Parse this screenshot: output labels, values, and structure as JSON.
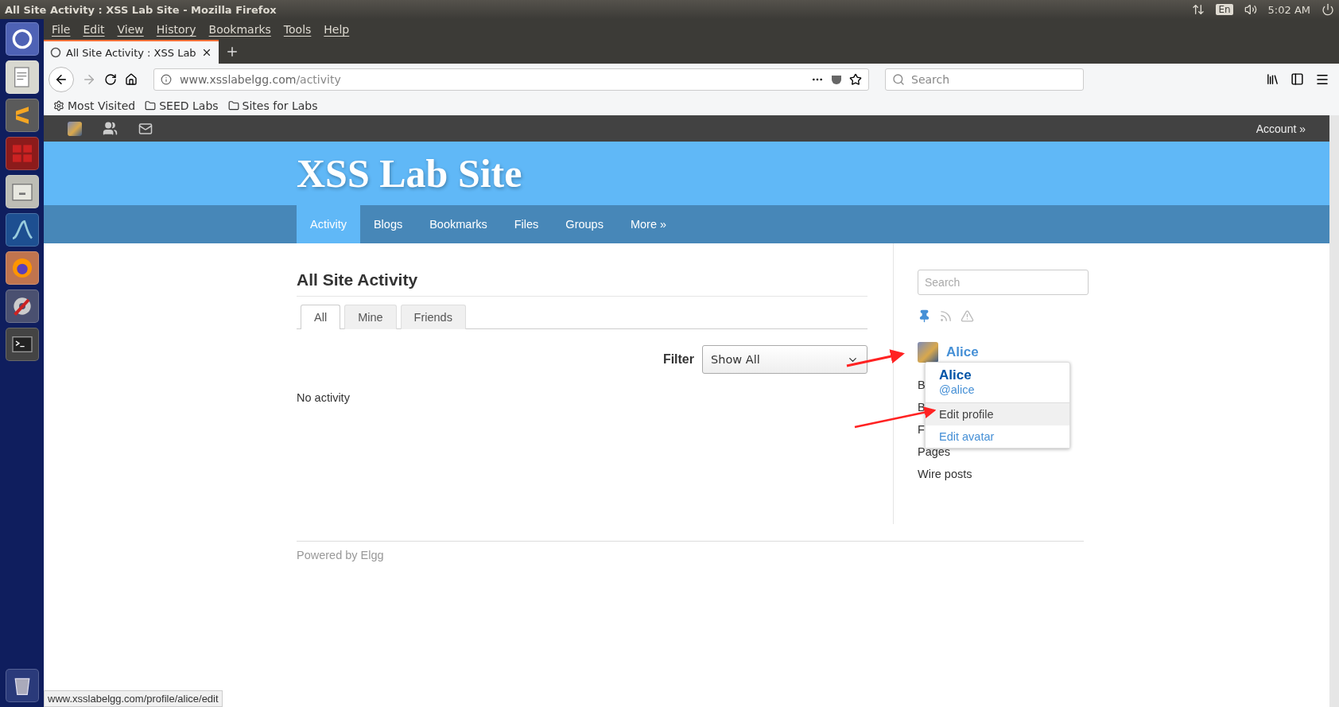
{
  "window": {
    "title": "All Site Activity : XSS Lab Site - Mozilla Firefox"
  },
  "system_tray": {
    "keyboard": "En",
    "time": "5:02 AM"
  },
  "launcher": [
    {
      "kind": "ubuntu"
    },
    {
      "kind": "editor"
    },
    {
      "kind": "sublime"
    },
    {
      "kind": "terminals"
    },
    {
      "kind": "files"
    },
    {
      "kind": "wireshark"
    },
    {
      "kind": "firefox"
    },
    {
      "kind": "settings"
    },
    {
      "kind": "terminal"
    }
  ],
  "menu_bar": [
    "File",
    "Edit",
    "View",
    "History",
    "Bookmarks",
    "Tools",
    "Help"
  ],
  "tabs": [
    {
      "label": "All Site Activity : XSS Lab",
      "selected": true
    }
  ],
  "address_bar": {
    "host": "www.xsslabelgg.com",
    "path": "/activity"
  },
  "search": {
    "placeholder": "Search"
  },
  "bookmarks": [
    "Most Visited",
    "SEED Labs",
    "Sites for Labs"
  ],
  "site": {
    "account": "Account »",
    "title": "XSS Lab Site",
    "nav": [
      {
        "label": "Activity",
        "selected": true
      },
      {
        "label": "Blogs",
        "selected": false
      },
      {
        "label": "Bookmarks",
        "selected": false
      },
      {
        "label": "Files",
        "selected": false
      },
      {
        "label": "Groups",
        "selected": false
      },
      {
        "label": "More »",
        "selected": false
      }
    ],
    "page_title": "All Site Activity",
    "filter_tabs": [
      {
        "label": "All",
        "selected": true
      },
      {
        "label": "Mine",
        "selected": false
      },
      {
        "label": "Friends",
        "selected": false
      }
    ],
    "filter_label": "Filter",
    "filter_value": "Show All",
    "empty": "No activity",
    "sidebar": {
      "search_placeholder": "Search",
      "user": "Alice",
      "links": [
        "B",
        "B",
        "F",
        "Pages",
        "Wire posts"
      ],
      "popup": {
        "name": "Alice",
        "handle": "@alice",
        "items": [
          {
            "label": "Edit profile",
            "selected": true
          },
          {
            "label": "Edit avatar",
            "selected": false
          }
        ]
      }
    },
    "footer": "Powered by Elgg"
  },
  "status_url": "www.xsslabelgg.com/profile/alice/edit"
}
